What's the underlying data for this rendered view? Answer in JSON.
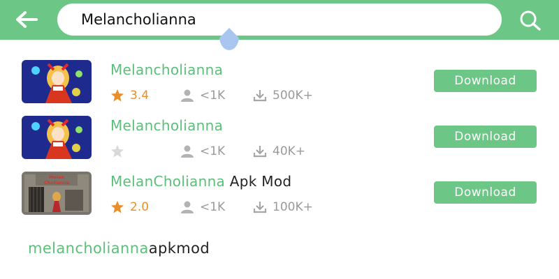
{
  "header": {
    "search_value": "Melancholianna",
    "back_icon": "arrow-left-icon",
    "search_icon": "magnifier-icon",
    "bar_color": "#6cc787"
  },
  "results": [
    {
      "title": "Melancholianna",
      "title_suffix": "",
      "rating": "3.4",
      "rating_active": true,
      "users": "<1K",
      "downloads": "500K+",
      "button": "Download",
      "thumb": "anime-girl-red-dress"
    },
    {
      "title": "Melancholianna",
      "title_suffix": "",
      "rating": "",
      "rating_active": false,
      "users": "<1K",
      "downloads": "40K+",
      "button": "Download",
      "thumb": "anime-girl-red-dress"
    },
    {
      "title": "MelanCholianna",
      "title_suffix": " Apk Mod",
      "rating": "2.0",
      "rating_active": true,
      "users": "<1K",
      "downloads": "100K+",
      "button": "Download",
      "thumb": "room-scene-title"
    }
  ],
  "suggestion": {
    "highlight": "melancholianna",
    "rest": "apkmod"
  },
  "thumb_text": {
    "line1": "Melan",
    "line2": "Cholianna"
  },
  "colors": {
    "accent": "#6cc787",
    "star": "#e8902e",
    "muted": "#9a9a9a"
  }
}
